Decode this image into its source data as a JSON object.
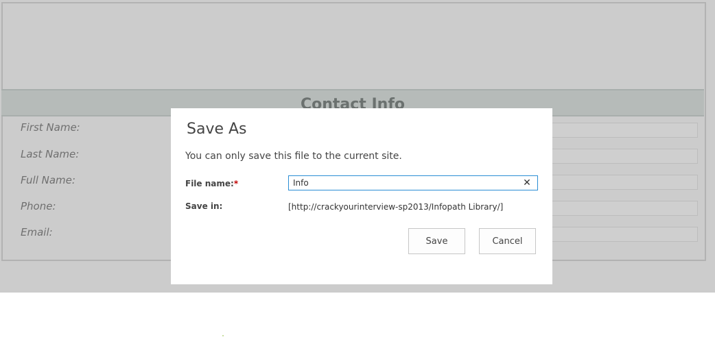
{
  "form": {
    "section_title": "Contact Info",
    "fields": [
      {
        "label": "First Name:"
      },
      {
        "label": "Last Name:"
      },
      {
        "label": "Full Name:"
      },
      {
        "label": "Phone:"
      },
      {
        "label": "Email:"
      }
    ]
  },
  "dialog": {
    "title": "Save As",
    "message": "You can only save this file to the current site.",
    "file_name_label": "File name:",
    "required_marker": "*",
    "file_name_value": "Info",
    "clear_icon": "close-icon",
    "save_in_label": "Save in:",
    "save_in_value": "[http://crackyourinterview-sp2013/Infopath Library/]",
    "save_label": "Save",
    "cancel_label": "Cancel"
  },
  "colors": {
    "overlay": "#cccccc",
    "section_bar": "#b6bbb9",
    "input_focus_border": "#2a8dd4",
    "required": "#c00000"
  }
}
